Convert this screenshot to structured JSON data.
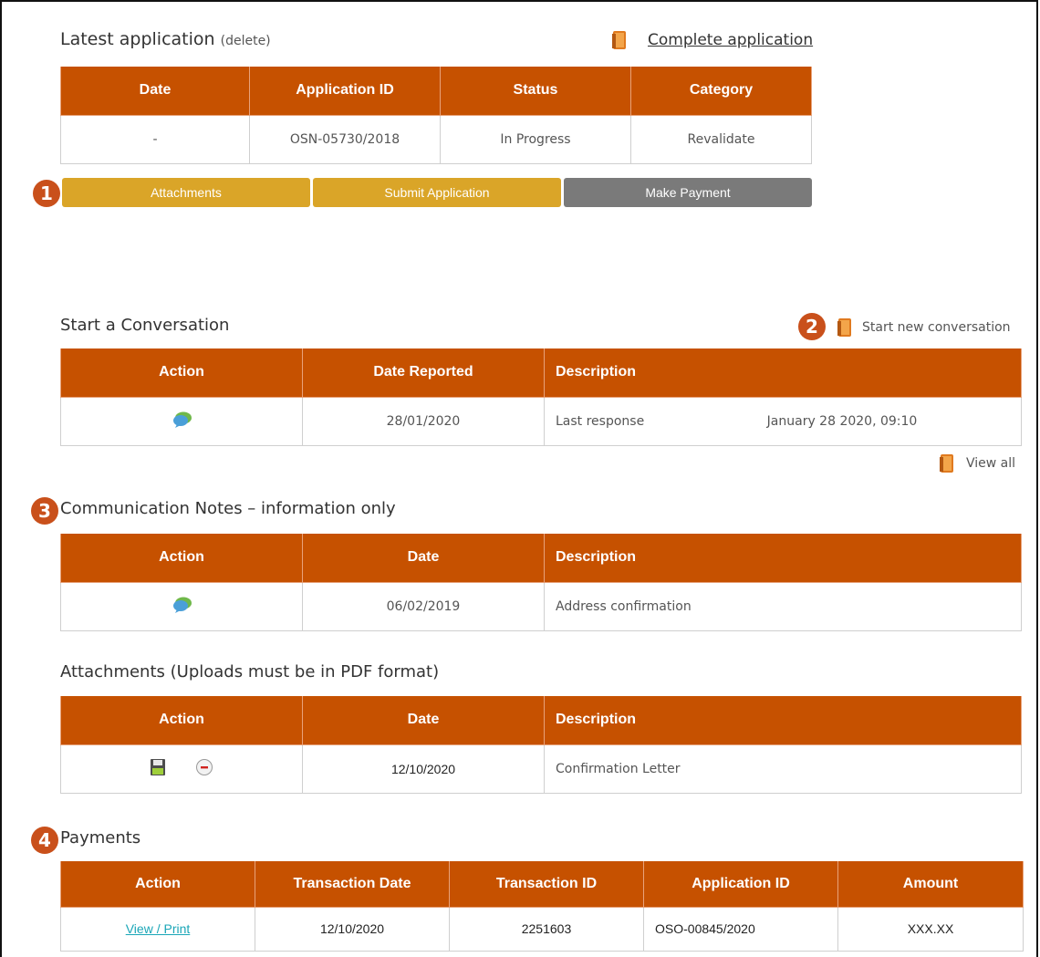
{
  "latest": {
    "title": "Latest application",
    "delete_label": "(delete)",
    "complete_link": "Complete application",
    "headers": [
      "Date",
      "Application ID",
      "Status",
      "Category"
    ],
    "row": [
      "-",
      "OSN-05730/2018",
      "In Progress",
      "Revalidate"
    ]
  },
  "buttons": {
    "attachments": "Attachments",
    "submit": "Submit Application",
    "payment": "Make Payment"
  },
  "badges": [
    "1",
    "2",
    "3",
    "4"
  ],
  "conversation": {
    "title": "Start a Conversation",
    "new_link": "Start new conversation",
    "headers": [
      "Action",
      "Date Reported",
      "Description"
    ],
    "row": {
      "date": "28/01/2020",
      "desc": "Last response",
      "time": "January 28 2020, 09:10"
    },
    "view_all": "View all"
  },
  "notes": {
    "title": "Communication Notes – information only",
    "headers": [
      "Action",
      "Date",
      "Description"
    ],
    "row": {
      "date": "06/02/2019",
      "desc": "Address confirmation"
    }
  },
  "attachments": {
    "title": "Attachments (Uploads must be in PDF format)",
    "headers": [
      "Action",
      "Date",
      "Description"
    ],
    "row": {
      "date": "12/10/2020",
      "desc": "Confirmation Letter"
    }
  },
  "payments": {
    "title": "Payments",
    "headers": [
      "Action",
      "Transaction Date",
      "Transaction ID",
      "Application ID",
      "Amount"
    ],
    "row": {
      "action": "View / Print",
      "date": "12/10/2020",
      "txid": "2251603",
      "appid": "OSO-00845/2020",
      "amount": "XXX.XX"
    }
  },
  "colors": {
    "header": "#c65100",
    "gold": "#daa528",
    "grey": "#7a7a7a",
    "badge": "#c9501b",
    "link": "#1aa6b7"
  }
}
